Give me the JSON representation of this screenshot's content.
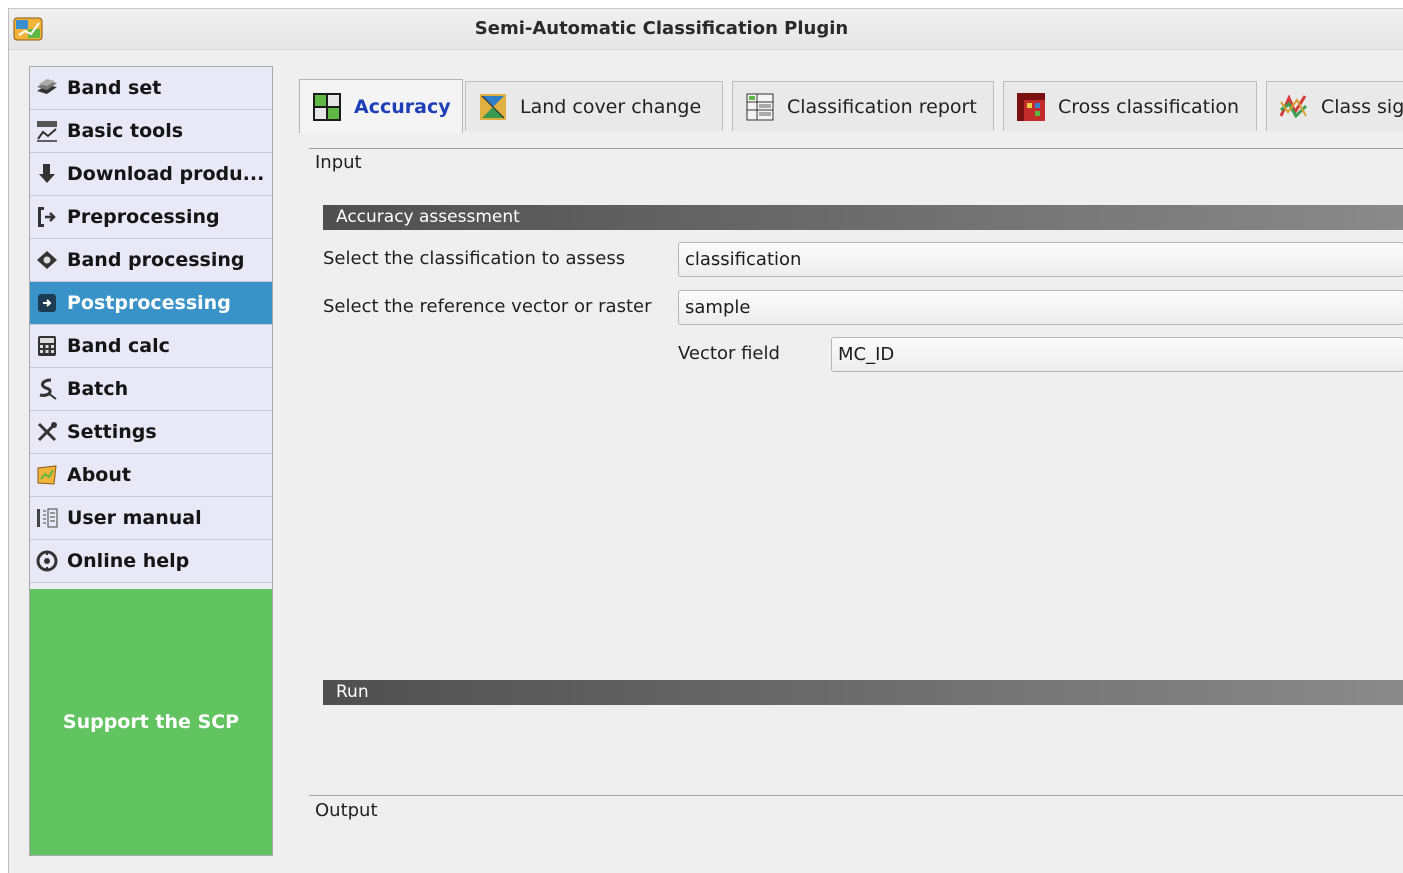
{
  "window": {
    "title": "Semi-Automatic Classification Plugin"
  },
  "sidebar": {
    "items": [
      {
        "label": "Band set",
        "icon": "band-set-icon"
      },
      {
        "label": "Basic tools",
        "icon": "basic-tools-icon"
      },
      {
        "label": "Download produ...",
        "icon": "download-icon"
      },
      {
        "label": "Preprocessing",
        "icon": "preprocessing-icon"
      },
      {
        "label": "Band processing",
        "icon": "band-processing-icon"
      },
      {
        "label": "Postprocessing",
        "icon": "postprocessing-icon",
        "selected": true
      },
      {
        "label": "Band calc",
        "icon": "calculator-icon"
      },
      {
        "label": "Batch",
        "icon": "batch-icon"
      },
      {
        "label": "Settings",
        "icon": "settings-icon"
      },
      {
        "label": "About",
        "icon": "about-icon"
      },
      {
        "label": "User manual",
        "icon": "book-icon"
      },
      {
        "label": "Online help",
        "icon": "help-icon"
      }
    ],
    "support_label": "Support the SCP"
  },
  "tabs": [
    {
      "label": "Accuracy",
      "icon": "accuracy-icon",
      "active": true
    },
    {
      "label": "Land cover change",
      "icon": "land-cover-change-icon"
    },
    {
      "label": "Classification report",
      "icon": "classification-report-icon"
    },
    {
      "label": "Cross classification",
      "icon": "cross-classification-icon"
    },
    {
      "label": "Class sigr",
      "icon": "class-signature-icon"
    }
  ],
  "main": {
    "input_label": "Input",
    "accuracy_section": "Accuracy assessment",
    "classification_label": "Select the classification to assess",
    "classification_value": "classification",
    "reference_label": "Select the reference vector or raster",
    "reference_value": "sample",
    "vector_field_label": "Vector field",
    "vector_field_value": "MC_ID",
    "run_section": "Run",
    "output_label": "Output"
  },
  "colors": {
    "selected_item": "#3a93c8",
    "support_bg": "#62c460",
    "active_tab_text": "#1c3fb8",
    "section_bar_dark": "#4f4f4f"
  }
}
